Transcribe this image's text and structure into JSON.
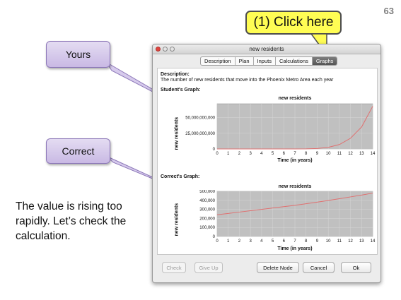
{
  "slide_number": "63",
  "callouts": {
    "click_here": "(1) Click here",
    "yours": "Yours",
    "correct": "Correct"
  },
  "side_text": "The value is rising too rapidly.  Let’s check the calculation.",
  "window": {
    "title": "new residents",
    "tabs": [
      {
        "label": "Description",
        "active": false
      },
      {
        "label": "Plan",
        "active": false
      },
      {
        "label": "Inputs",
        "active": false
      },
      {
        "label": "Calculations",
        "active": false
      },
      {
        "label": "Graphs",
        "active": true
      }
    ],
    "description_label": "Description:",
    "description_text": "The number of new residents that move into the Phoenix Metro Area each year",
    "student_graph_label": "Student's Graph:",
    "correct_graph_label": "Correct's Graph:",
    "buttons": {
      "check": "Check",
      "give_up": "Give Up",
      "delete_node": "Delete Node",
      "cancel": "Cancel",
      "ok": "Ok"
    },
    "colors": {
      "line": "#e07070",
      "plot_bg": "#c0c0c0",
      "active_tab": "#5a5a5a"
    }
  },
  "chart_data": [
    {
      "type": "line",
      "title": "new residents",
      "xlabel": "Time (in years)",
      "ylabel": "new residents",
      "x": [
        0,
        1,
        2,
        3,
        4,
        5,
        6,
        7,
        8,
        9,
        10,
        11,
        12,
        13,
        14
      ],
      "ticks_x": [
        "0",
        "1",
        "2",
        "3",
        "4",
        "5",
        "6",
        "7",
        "8",
        "9",
        "10",
        "11",
        "12",
        "13",
        "14"
      ],
      "ticks_y": [
        "0",
        "25,000,000,000",
        "50,000,000,000"
      ],
      "y_tick_values": [
        0,
        25000000000,
        50000000000
      ],
      "ylim": [
        0,
        72000000000
      ],
      "series": [
        {
          "values": [
            0,
            0,
            0,
            0,
            0,
            0,
            0,
            30000000,
            150000000,
            700000000,
            2500000000,
            7000000000,
            17000000000,
            35000000000,
            68000000000
          ]
        }
      ],
      "grid": true
    },
    {
      "type": "line",
      "title": "new residents",
      "xlabel": "Time (in years)",
      "ylabel": "new residents",
      "x": [
        0,
        1,
        2,
        3,
        4,
        5,
        6,
        7,
        8,
        9,
        10,
        11,
        12,
        13,
        14
      ],
      "ticks_x": [
        "0",
        "1",
        "2",
        "3",
        "4",
        "5",
        "6",
        "7",
        "8",
        "9",
        "10",
        "11",
        "12",
        "13",
        "14"
      ],
      "ticks_y": [
        "0",
        "100,000",
        "200,000",
        "300,000",
        "400,000",
        "500,000"
      ],
      "y_tick_values": [
        0,
        100000,
        200000,
        300000,
        400000,
        500000
      ],
      "ylim": [
        0,
        500000
      ],
      "series": [
        {
          "values": [
            240000,
            255000,
            270000,
            285000,
            300000,
            315000,
            330000,
            345000,
            362000,
            380000,
            398000,
            418000,
            438000,
            458000,
            480000
          ]
        }
      ],
      "grid": true
    }
  ]
}
